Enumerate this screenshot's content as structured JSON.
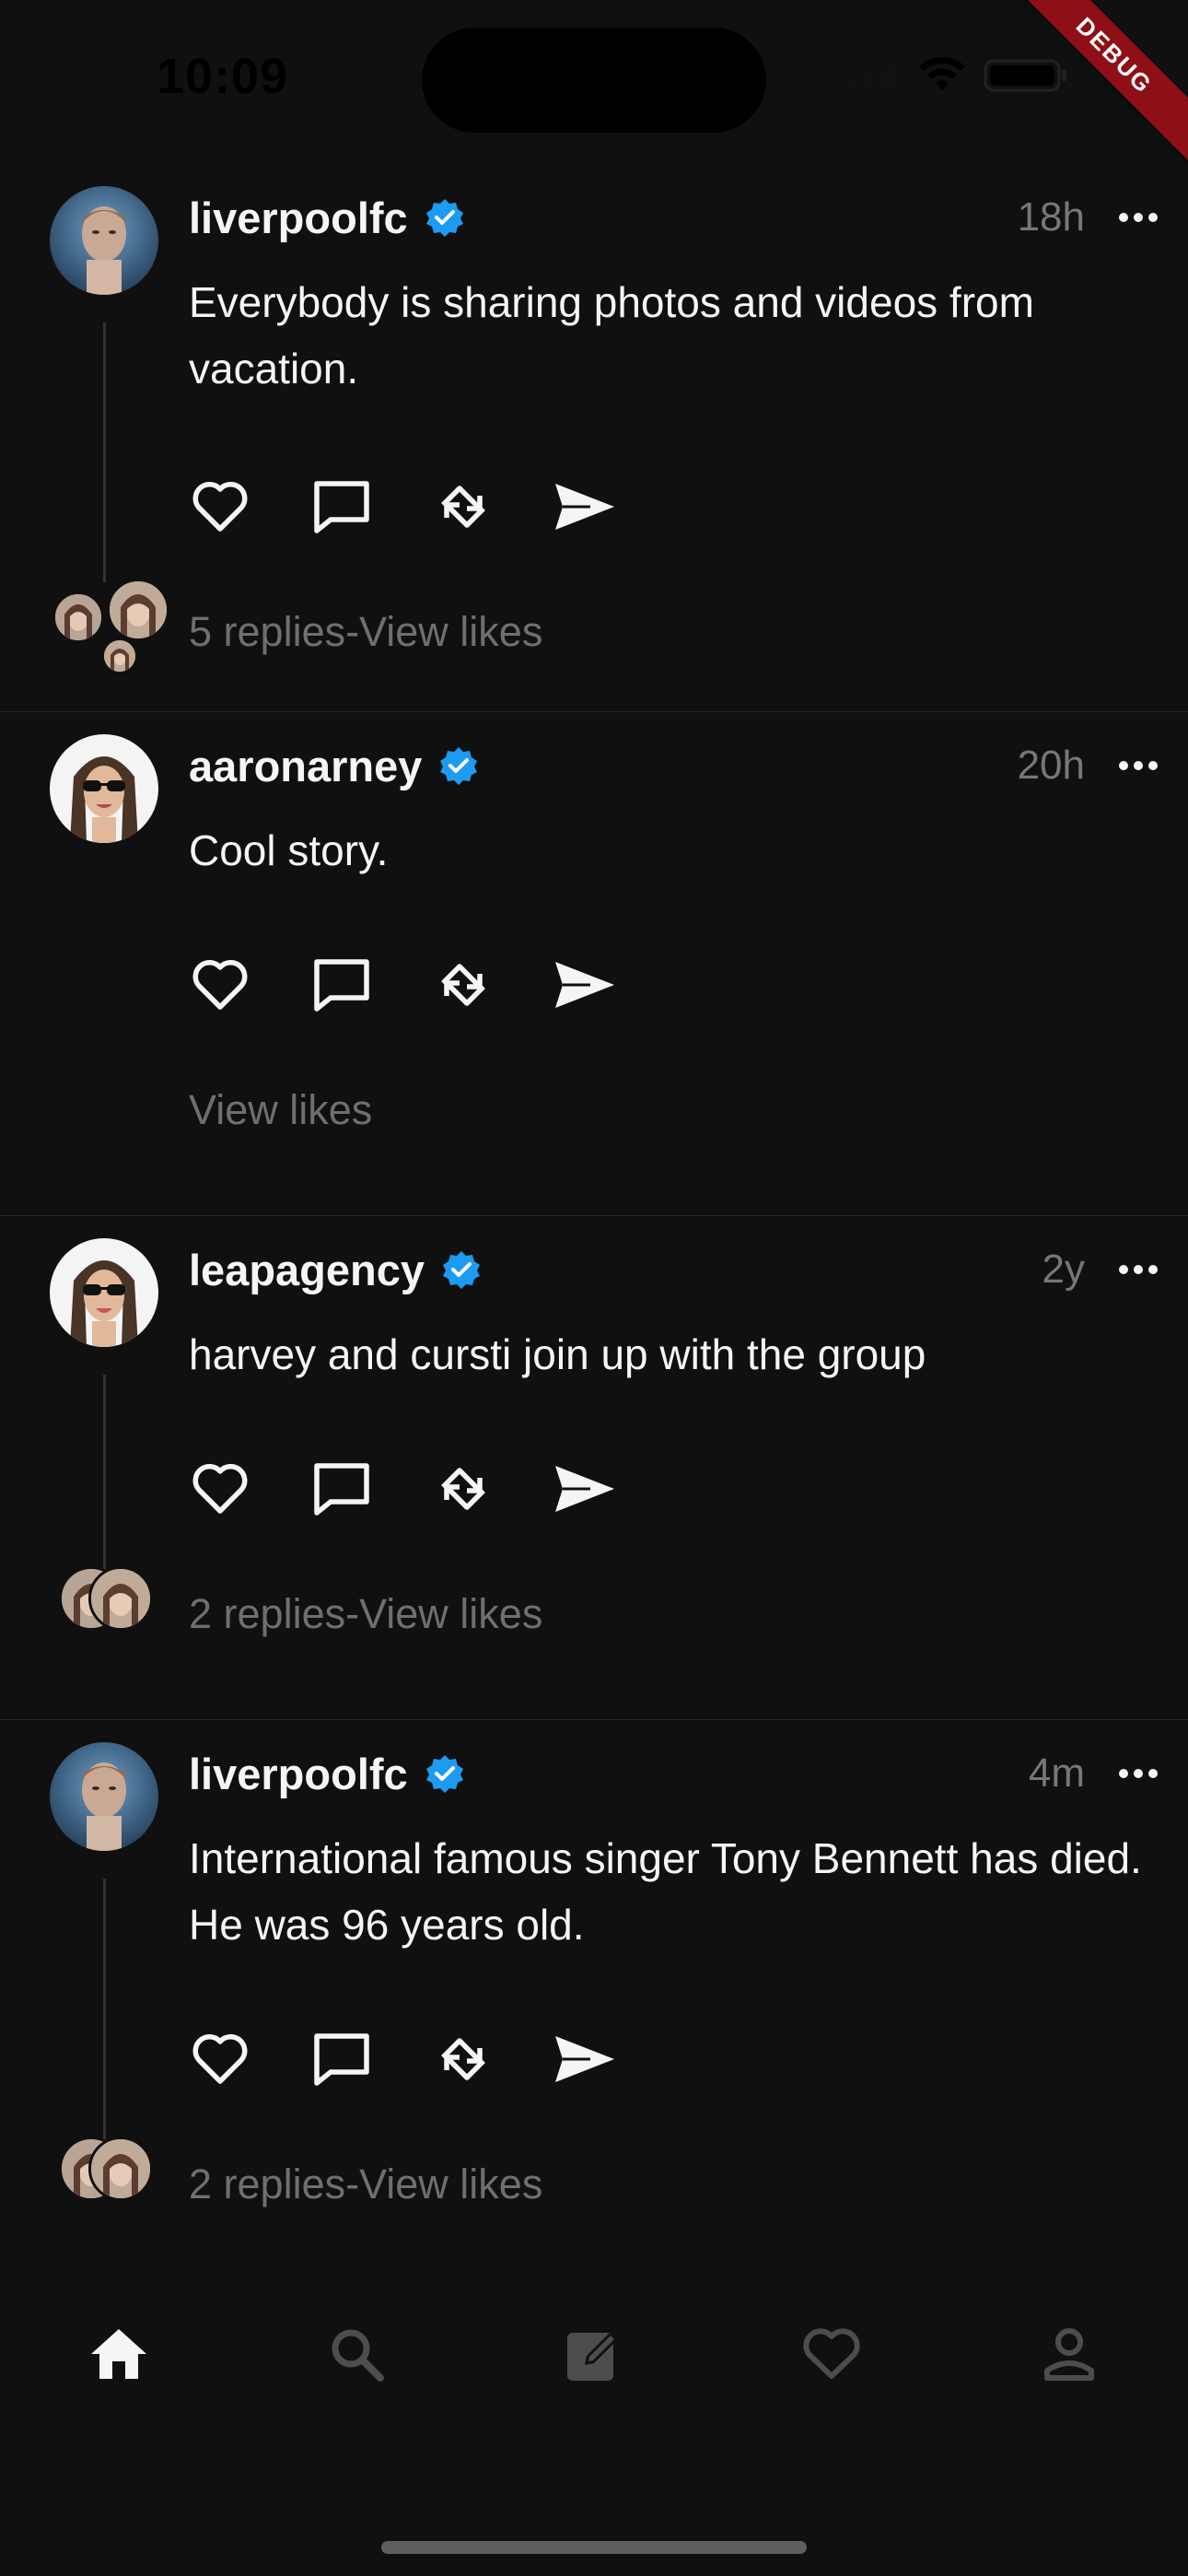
{
  "status_bar": {
    "time": "10:09",
    "debug_label": "DEBUG"
  },
  "posts": [
    {
      "username": "liverpoolfc",
      "verified": true,
      "timestamp": "18h",
      "text": "Everybody is sharing photos and videos from vacation.",
      "meta": "5 replies-View likes",
      "avatar": "man-portrait"
    },
    {
      "username": "aaronarney",
      "verified": true,
      "timestamp": "20h",
      "text": "Cool story.",
      "meta": "View likes",
      "avatar": "sunglasses-portrait"
    },
    {
      "username": "leapagency",
      "verified": true,
      "timestamp": "2y",
      "text": "harvey and cursti join up with the group",
      "meta": "2 replies-View likes",
      "avatar": "sunglasses-portrait"
    },
    {
      "username": "liverpoolfc",
      "verified": true,
      "timestamp": "4m",
      "text": "International famous singer Tony Bennett has died. He was 96 years old.",
      "meta": "2 replies-View likes",
      "avatar": "man-portrait"
    }
  ],
  "actions": [
    "heart-icon",
    "comment-icon",
    "repost-icon",
    "send-icon"
  ],
  "bottom_nav": [
    "home-icon",
    "search-icon",
    "compose-icon",
    "activity-heart-icon",
    "profile-icon"
  ],
  "colors": {
    "background": "#101010",
    "text": "#f3f5f7",
    "muted": "#777777",
    "verified": "#1d9bf0",
    "debug_ribbon": "#8f0f16"
  }
}
